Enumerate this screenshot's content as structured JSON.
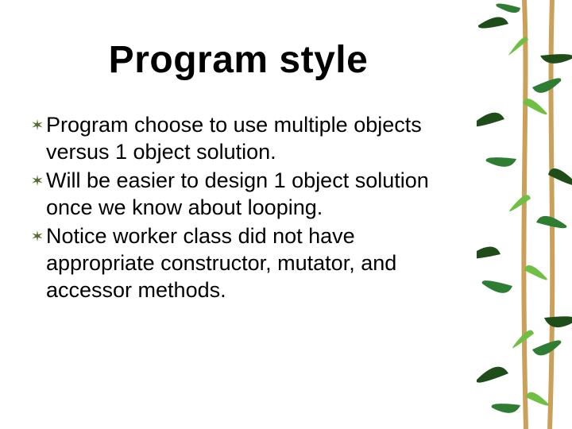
{
  "title": "Program style",
  "bullets": [
    "Program choose to use multiple objects versus 1 object solution.",
    "Will be easier to design 1 object solution once we know about looping.",
    "Notice worker class did not have appropriate constructor, mutator, and accessor methods."
  ],
  "colors": {
    "bullet": "#556b2f",
    "text": "#000000",
    "leaf_dark": "#1e4d1a",
    "leaf_mid": "#2e7d32",
    "leaf_light": "#6fbf44",
    "stem": "#c9a15a"
  }
}
